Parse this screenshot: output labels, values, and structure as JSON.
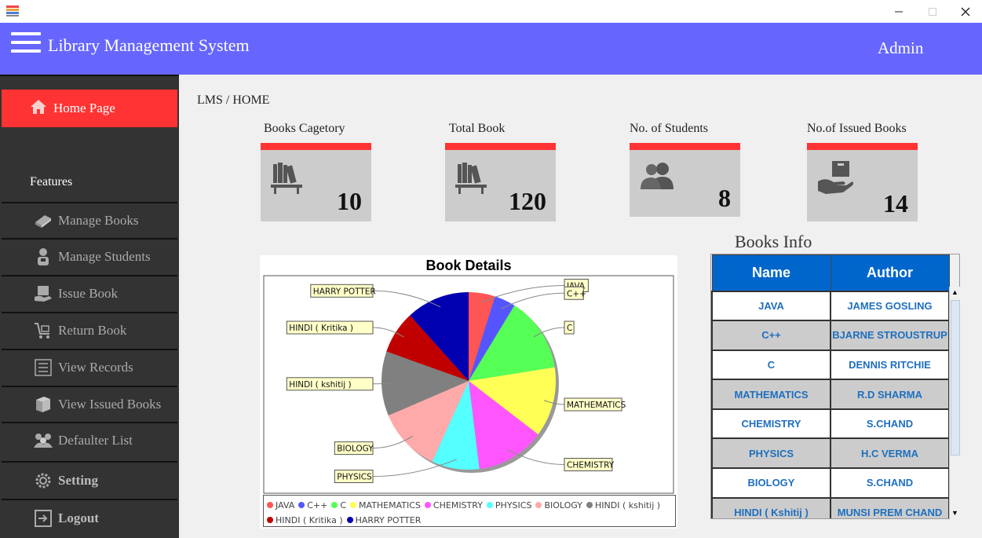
{
  "header": {
    "title": "Library Management System",
    "user": "Admin"
  },
  "colors": {
    "header": "#6666ff",
    "accent": "#ff3333",
    "sidebar": "#333333",
    "table_header": "#0066cc"
  },
  "sidebar": {
    "home": "Home Page",
    "features_heading": "Features",
    "items": [
      {
        "label": "Manage Books",
        "icon": "book-icon"
      },
      {
        "label": "Manage Students",
        "icon": "student-icon"
      },
      {
        "label": "Issue Book",
        "icon": "issue-book-icon"
      },
      {
        "label": "Return Book",
        "icon": "cart-icon"
      },
      {
        "label": "View Records",
        "icon": "list-icon"
      },
      {
        "label": "View Issued Books",
        "icon": "books-icon"
      },
      {
        "label": "Defaulter List",
        "icon": "group-icon"
      }
    ],
    "setting": "Setting",
    "logout": "Logout"
  },
  "breadcrumb": "LMS / HOME",
  "stats": [
    {
      "label": "Books Cagetory",
      "value": "10",
      "icon": "bookshelf-icon"
    },
    {
      "label": "Total Book",
      "value": "120",
      "icon": "bookshelf-icon"
    },
    {
      "label": "No. of Students",
      "value": "8",
      "icon": "users-icon"
    },
    {
      "label": "No.of Issued Books",
      "value": "14",
      "icon": "hand-box-icon"
    }
  ],
  "chart_data": {
    "type": "pie",
    "title": "Book Details",
    "legend": "bottom",
    "slices": [
      {
        "label": "JAVA",
        "value": 5,
        "color": "#ff5555"
      },
      {
        "label": "C++",
        "value": 4,
        "color": "#5555ff"
      },
      {
        "label": "C",
        "value": 14,
        "color": "#55ff55"
      },
      {
        "label": "MATHEMATICS",
        "value": 13,
        "color": "#ffff55"
      },
      {
        "label": "CHEMISTRY",
        "value": 13,
        "color": "#ff55ff"
      },
      {
        "label": "PHYSICS",
        "value": 9,
        "color": "#55ffff"
      },
      {
        "label": "BIOLOGY",
        "value": 12,
        "color": "#ffaaaa"
      },
      {
        "label": "HINDI ( kshitij )",
        "value": 12,
        "color": "#808080"
      },
      {
        "label": "HINDI ( Kritika )",
        "value": 8,
        "color": "#c00000"
      },
      {
        "label": "HARRY POTTER",
        "value": 12,
        "color": "#0000b0"
      }
    ],
    "callouts": [
      "JAVA",
      "C++",
      "C",
      "MATHEMATICS",
      "CHEMISTRY",
      "PHYSICS",
      "BIOLOGY",
      "HINDI ( kshitij )",
      "HINDI ( Kritika )",
      "HARRY POTTER"
    ]
  },
  "books_info": {
    "title": "Books  Info",
    "columns": [
      "Name",
      "Author"
    ],
    "rows": [
      [
        "JAVA",
        "JAMES GOSLING"
      ],
      [
        "C++",
        "BJARNE STROUSTRUP"
      ],
      [
        "C",
        "DENNIS RITCHIE"
      ],
      [
        "MATHEMATICS",
        "R.D SHARMA"
      ],
      [
        "CHEMISTRY",
        "S.CHAND"
      ],
      [
        "PHYSICS",
        "H.C VERMA"
      ],
      [
        "BIOLOGY",
        "S.CHAND"
      ],
      [
        "HINDI ( Kshitij )",
        "MUNSI PREM CHAND"
      ]
    ]
  }
}
